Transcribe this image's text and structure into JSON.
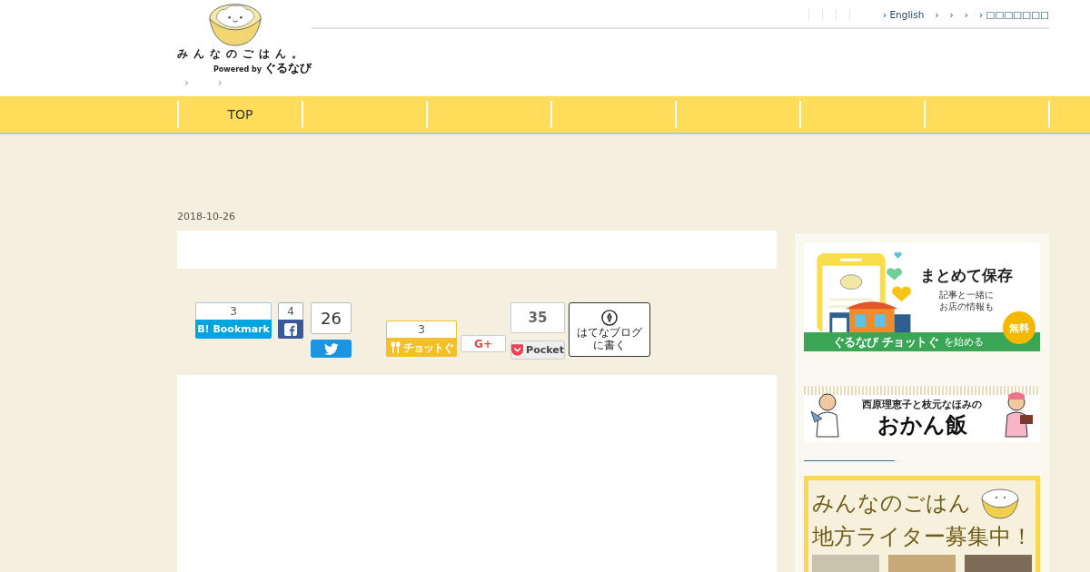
{
  "header": {
    "logo": {
      "title": "みんなのごはん。",
      "powered_by": "Powered by",
      "brand": "ぐるなび"
    },
    "top_links": [
      "› English",
      "›",
      "›",
      "›",
      "› □□□□□□□"
    ],
    "breadcrumb": [
      "›",
      "›"
    ]
  },
  "nav": {
    "items": [
      {
        "label": "TOP"
      }
    ]
  },
  "article": {
    "date": "2018-10-26",
    "share_buttons": [
      {
        "kind": "hatena",
        "count": "3",
        "label": "B! Bookmark"
      },
      {
        "kind": "facebook",
        "count": "4"
      },
      {
        "kind": "twitter",
        "count": "26"
      },
      {
        "kind": "chottogu",
        "count": "3",
        "label": "チョットぐ"
      },
      {
        "kind": "gplus",
        "label": "G+"
      },
      {
        "kind": "pocket",
        "count": "35",
        "label": "Pocket"
      },
      {
        "kind": "hatenablog",
        "lines": [
          "はてなブログ",
          "に書く"
        ]
      }
    ]
  },
  "sidebar": {
    "banners": [
      {
        "kind": "app_promo",
        "headline": "まとめて保存",
        "lines": [
          "記事と一緒に",
          "お店の情報も"
        ],
        "badge": "無料",
        "brand": "ぐるなび チョットぐ",
        "cta": "を始める"
      },
      {
        "kind": "column",
        "subtitle": "西原理恵子と枝元なほみの",
        "title": "おかん飯"
      },
      {
        "kind": "recruit",
        "title": "みんなのごはん",
        "headline": "地方ライター募集中！"
      }
    ]
  }
}
